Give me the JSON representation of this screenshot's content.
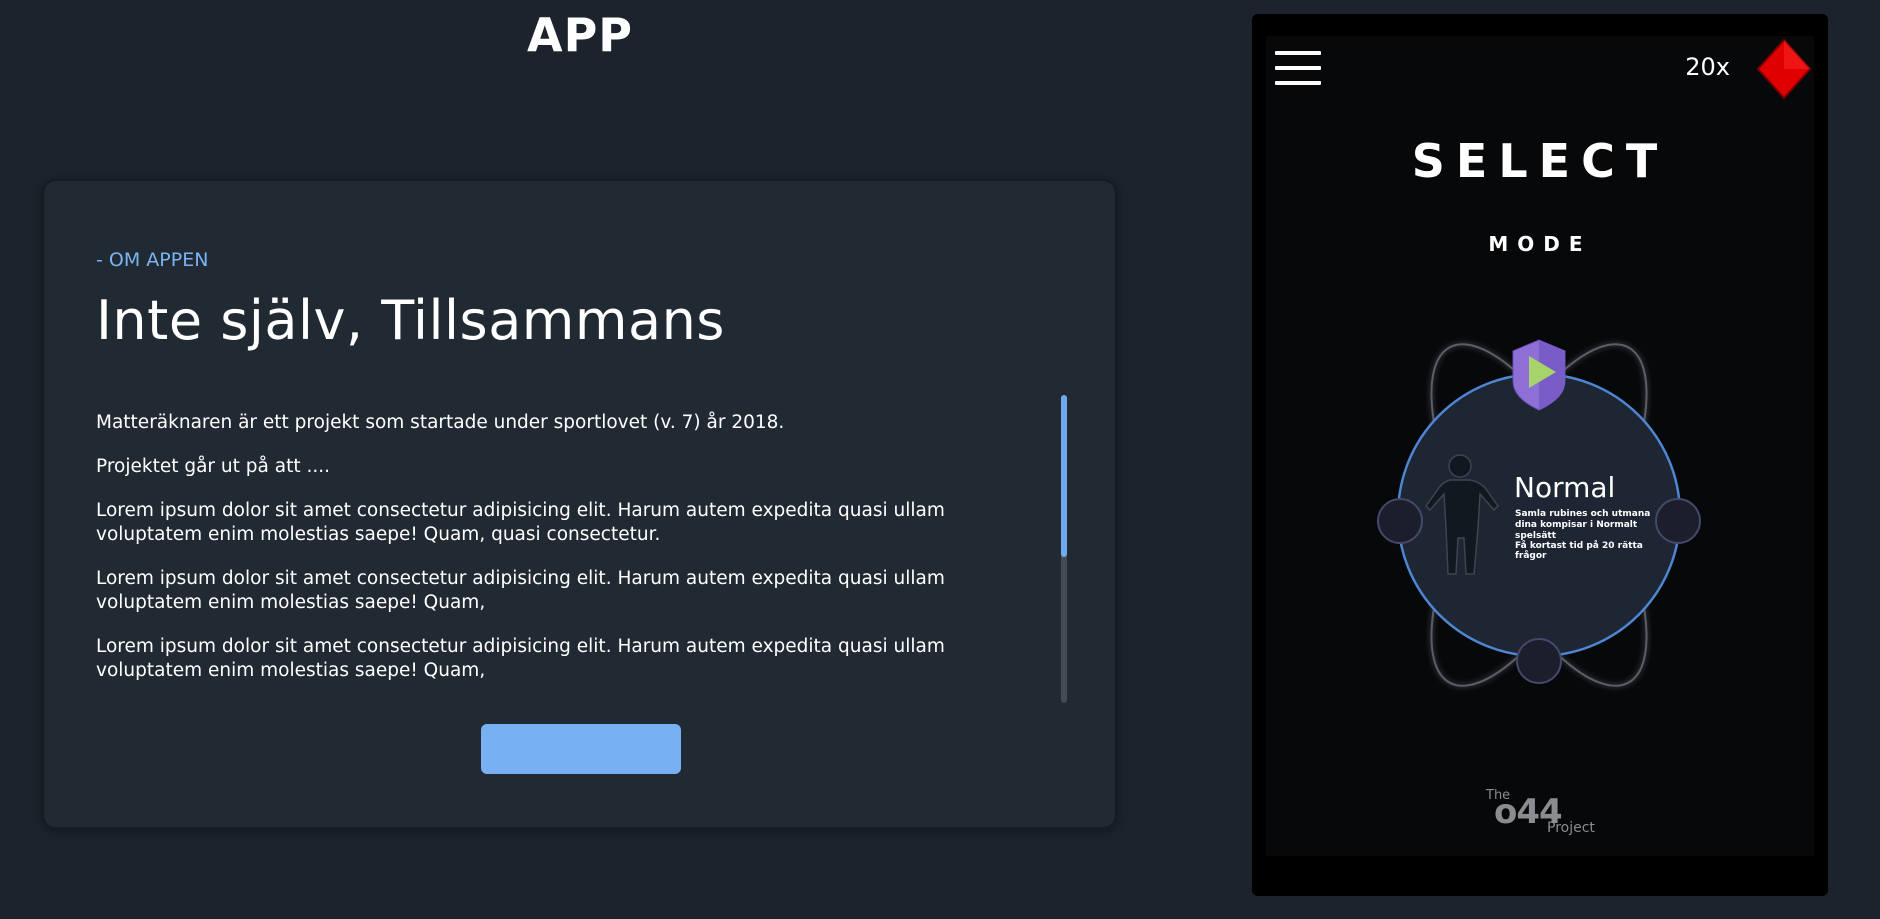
{
  "page": {
    "title": "APP"
  },
  "about": {
    "kicker": "- OM APPEN",
    "headline": "Inte själv, Tillsammans",
    "paragraphs": [
      "Matteräknaren är ett projekt som startade under sportlovet (v. 7) år 2018.",
      "Projektet går ut på att ....",
      "Lorem ipsum dolor sit amet consectetur adipisicing elit. Harum autem expedita quasi ullam voluptatem enim molestias saepe! Quam, quasi consectetur.",
      "Lorem ipsum dolor sit amet consectetur adipisicing elit. Harum autem expedita quasi ullam voluptatem enim molestias saepe! Quam,",
      "Lorem ipsum dolor sit amet consectetur adipisicing elit. Harum autem expedita quasi ullam voluptatem enim molestias saepe! Quam,"
    ],
    "button_label": "",
    "accent_color": "#78b1f3"
  },
  "phone": {
    "gem_count": "20x",
    "gem_icon": "ruby-diamond-icon",
    "menu_icon": "hamburger-menu-icon",
    "title": "SELECT",
    "subtitle": "MODE",
    "mode": {
      "name": "Normal",
      "description": "Samla rubines och utmana dina kompisar i Normalt spelsätt",
      "goal": "Få kortast tid på 20 rätta frågor",
      "badge_icon": "shield-play-icon"
    },
    "logo": {
      "the": "The",
      "number": "o44",
      "project": "Project"
    },
    "colors": {
      "ring": "#4e86d4",
      "shield": "#8e6fd6",
      "play": "#a6d36a",
      "gem": "#e00000"
    }
  }
}
